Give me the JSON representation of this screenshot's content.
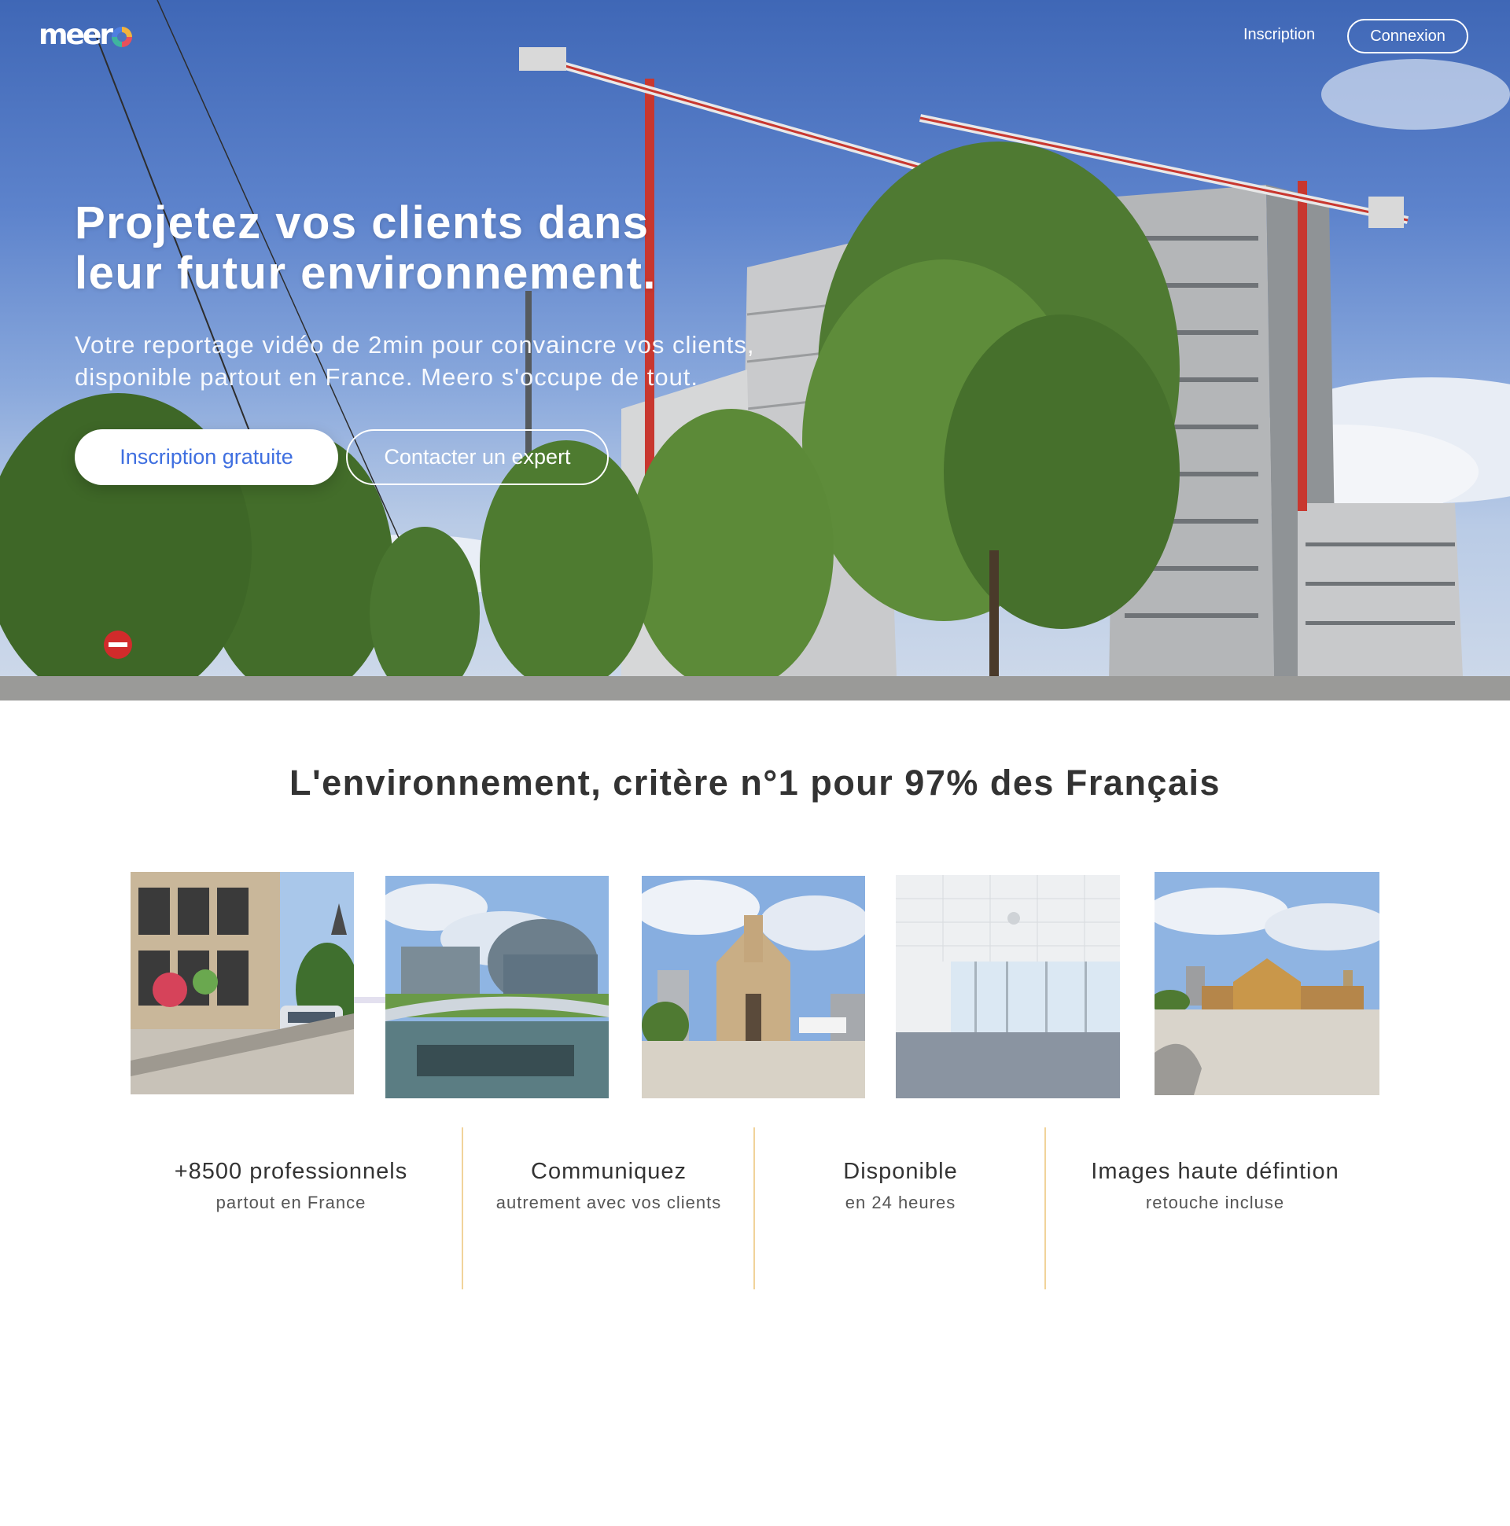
{
  "header": {
    "logo_text": "meer",
    "signup_label": "Inscription",
    "login_label": "Connexion"
  },
  "hero": {
    "title_line1": "Projetez vos clients dans",
    "title_line2": "leur futur environnement.",
    "subtitle_line1": "Votre reportage vidéo de 2min pour convaincre vos clients,",
    "subtitle_line2": "disponible partout en France. Meero s'occupe de tout.",
    "primary_cta": "Inscription gratuite",
    "secondary_cta": "Contacter un expert"
  },
  "section": {
    "title": "L'environnement, critère n°1 pour 97% des Français"
  },
  "thumbnails": [
    {
      "icon": "tram-street-photo"
    },
    {
      "icon": "parliament-bridge-photo"
    },
    {
      "icon": "church-square-photo"
    },
    {
      "icon": "empty-office-photo"
    },
    {
      "icon": "market-hall-photo"
    }
  ],
  "features": [
    {
      "title": "+8500 professionnels",
      "subtitle": "partout en France"
    },
    {
      "title": "Communiquez",
      "subtitle": "autrement avec vos clients"
    },
    {
      "title": "Disponible",
      "subtitle": "en 24 heures"
    },
    {
      "title": "Images haute défintion",
      "subtitle": "retouche incluse"
    }
  ],
  "colors": {
    "brand_blue": "#3f6fe0",
    "divider_gold": "#f1d39a",
    "text_dark": "#333333"
  }
}
